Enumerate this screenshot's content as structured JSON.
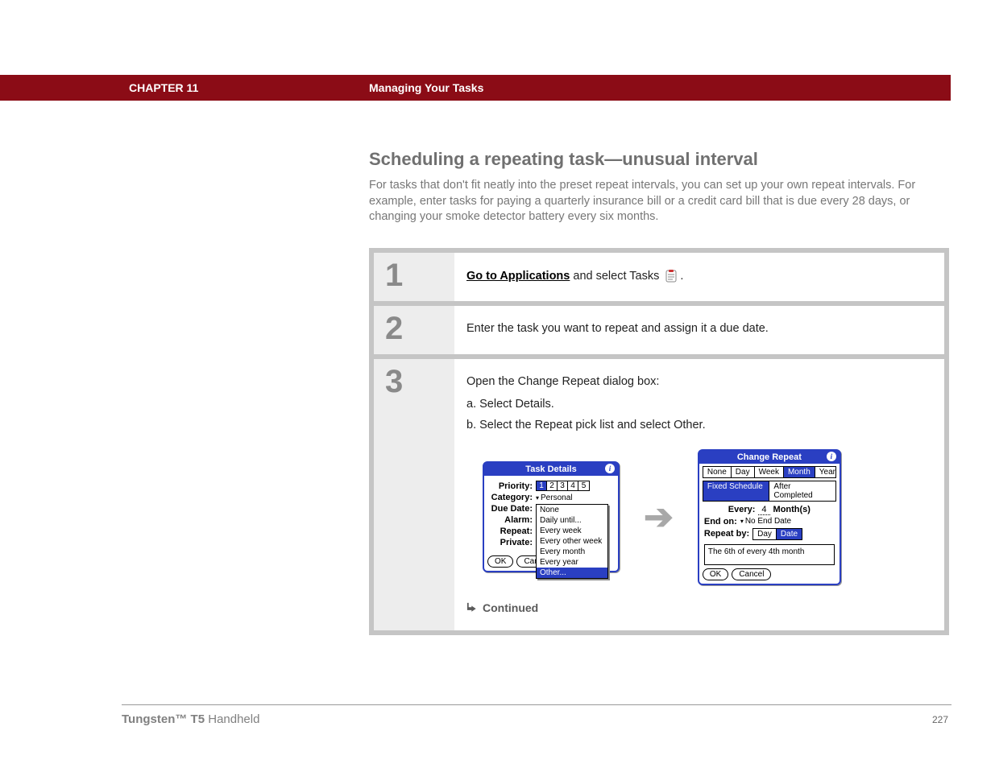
{
  "header": {
    "chapter": "CHAPTER 11",
    "title": "Managing Your Tasks"
  },
  "section": {
    "title": "Scheduling a repeating task—unusual interval",
    "intro": "For tasks that don't fit neatly into the preset repeat intervals, you can set up your own repeat intervals. For example, enter tasks for paying a quarterly insurance bill or a credit card bill that is due every 28 days, or changing your smoke detector battery every six months."
  },
  "steps": {
    "s1": {
      "num": "1",
      "link": "Go to Applications",
      "rest": " and select Tasks ",
      "period": "."
    },
    "s2": {
      "num": "2",
      "text": "Enter the task you want to repeat and assign it a due date."
    },
    "s3": {
      "num": "3",
      "intro": "Open the Change Repeat dialog box:",
      "a": "a.  Select Details.",
      "b": "b.  Select the Repeat pick list and select Other."
    }
  },
  "taskDetails": {
    "title": "Task Details",
    "priority_label": "Priority:",
    "priorities": {
      "p1": "1",
      "p2": "2",
      "p3": "3",
      "p4": "4",
      "p5": "5"
    },
    "category_label": "Category:",
    "category_value": "Personal",
    "duedate_label": "Due Date:",
    "alarm_label": "Alarm:",
    "repeat_label": "Repeat:",
    "private_label": "Private:",
    "dropdown": {
      "none": "None",
      "daily": "Daily until...",
      "week": "Every week",
      "otherweek": "Every other week",
      "month": "Every month",
      "year": "Every year",
      "other": "Other..."
    },
    "ok": "OK",
    "cancel": "Can"
  },
  "changeRepeat": {
    "title": "Change Repeat",
    "tabs": {
      "none": "None",
      "day": "Day",
      "week": "Week",
      "month": "Month",
      "year": "Year"
    },
    "tabs2": {
      "fixed": "Fixed Schedule",
      "after": "After Completed"
    },
    "every_label": "Every:",
    "every_value": "4",
    "every_unit": "Month(s)",
    "endon_label": "End on:",
    "endon_value": "No End Date",
    "repeatby_label": "Repeat by:",
    "repeatby_day": "Day",
    "repeatby_date": "Date",
    "summary": "The 6th of every 4th month",
    "ok": "OK",
    "cancel": "Cancel"
  },
  "continued": "Continued",
  "footer": {
    "product_bold": "Tungsten™ T5",
    "product_rest": " Handheld",
    "page": "227"
  }
}
